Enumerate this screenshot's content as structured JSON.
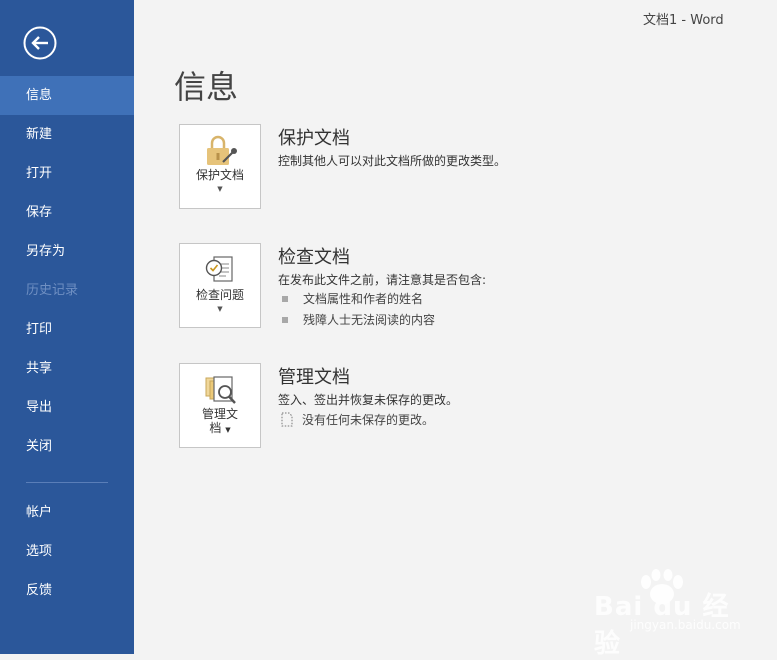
{
  "window_title": "文档1 - Word",
  "page_title": "信息",
  "nav": {
    "items": [
      {
        "label": "信息"
      },
      {
        "label": "新建"
      },
      {
        "label": "打开"
      },
      {
        "label": "保存"
      },
      {
        "label": "另存为"
      },
      {
        "label": "历史记录"
      },
      {
        "label": "打印"
      },
      {
        "label": "共享"
      },
      {
        "label": "导出"
      },
      {
        "label": "关闭"
      },
      {
        "label": "帐户"
      },
      {
        "label": "选项"
      },
      {
        "label": "反馈"
      }
    ]
  },
  "sections": {
    "protect": {
      "button_label": "保护文档",
      "heading": "保护文档",
      "description": "控制其他人可以对此文档所做的更改类型。"
    },
    "inspect": {
      "button_label": "检查问题",
      "heading": "检查文档",
      "description": "在发布此文件之前，请注意其是否包含:",
      "bullets": [
        "文档属性和作者的姓名",
        "残障人士无法阅读的内容"
      ]
    },
    "manage": {
      "button_label_line1": "管理文",
      "button_label_line2": "档",
      "heading": "管理文档",
      "description": "签入、签出并恢复未保存的更改。",
      "status": "没有任何未保存的更改。"
    }
  },
  "watermark": {
    "brand": "Bai du 经验",
    "url": "jingyan.baidu.com"
  },
  "colors": {
    "sidebar": "#2b579a",
    "sidebar_active": "#3f71b8",
    "background": "#f3f3f3"
  }
}
